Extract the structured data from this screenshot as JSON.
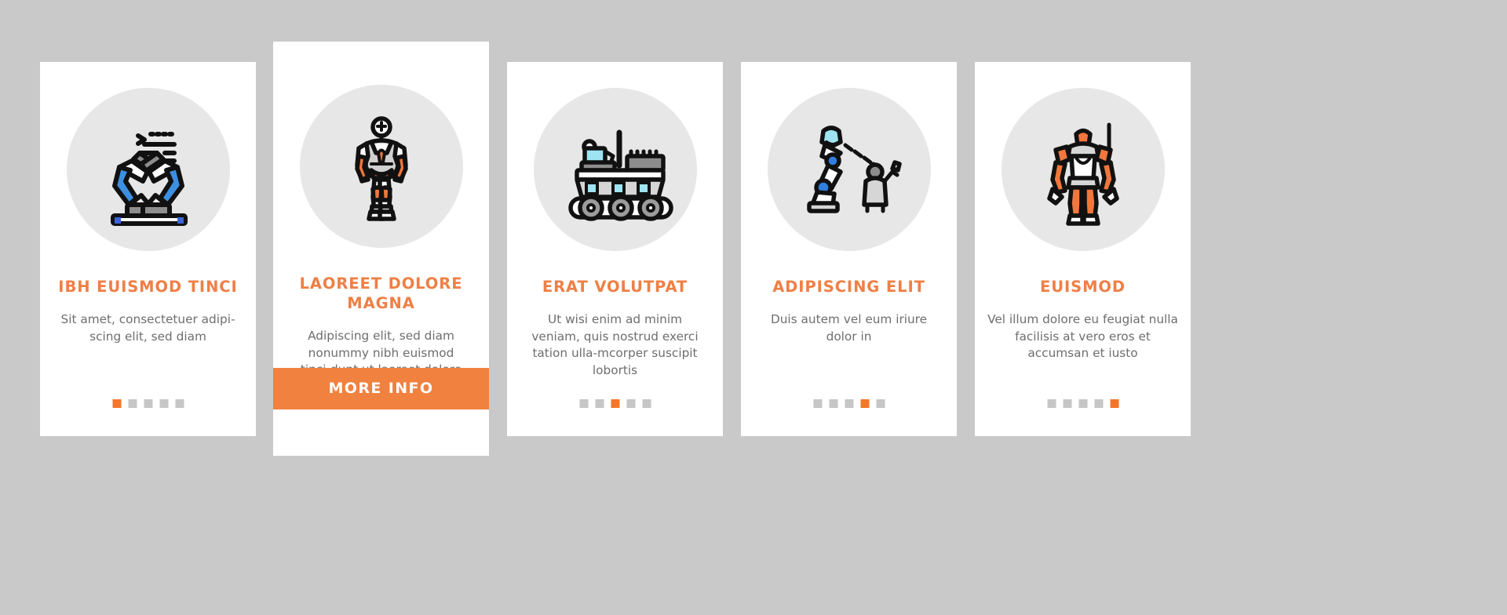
{
  "background_color": "#c9c9c9",
  "theme": {
    "card_bg": "#ffffff",
    "accent": "#ef7f45",
    "accent_button": "#f0813f",
    "dot_active": "#f4762a",
    "dot_inactive": "#c6c6c6",
    "body_text": "#6e6e6e",
    "icon_circle": "#e7e7e7"
  },
  "cards": [
    {
      "icon_name": "robotic-arms-assembly-line-icon",
      "title": "IBH EUISMOD TINCI",
      "body": "Sit amet, consectetuer adipi-scing elit, sed diam",
      "dots": {
        "count": 5,
        "active_index": 0
      },
      "featured": false
    },
    {
      "icon_name": "humanoid-robot-icon",
      "title": "LAOREET DOLORE MAGNA",
      "body": "Adipiscing elit, sed diam nonummy nibh euismod tinci-dunt ut laoreet dolore magna aliquam erat volutpat",
      "dots": {
        "count": 5,
        "active_index": 1
      },
      "featured": true,
      "button_label": "MORE INFO"
    },
    {
      "icon_name": "rover-tracked-vehicle-icon",
      "title": "ERAT VOLUTPAT",
      "body": "Ut wisi enim ad minim veniam, quis nostrud exerci tation ulla-mcorper suscipit lobortis",
      "dots": {
        "count": 5,
        "active_index": 2
      },
      "featured": false
    },
    {
      "icon_name": "robot-arm-operator-remote-icon",
      "title": "ADIPISCING ELIT",
      "body": "Duis autem vel eum iriure dolor in",
      "dots": {
        "count": 5,
        "active_index": 3
      },
      "featured": false
    },
    {
      "icon_name": "exoskeleton-mech-suit-icon",
      "title": "EUISMOD",
      "body": "Vel illum dolore eu feugiat nulla facilisis at vero eros et accumsan et iusto",
      "dots": {
        "count": 5,
        "active_index": 4
      },
      "featured": false
    }
  ]
}
